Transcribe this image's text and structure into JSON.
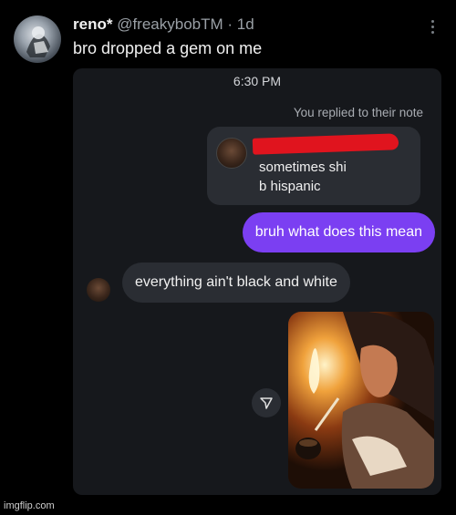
{
  "post": {
    "author_name": "reno*",
    "author_handle": "@freakybobTM · 1d",
    "text": "bro dropped a gem on me"
  },
  "dm": {
    "time": "6:30 PM",
    "reply_note": "You replied to their note",
    "note": {
      "line1": "sometimes shi",
      "line2": "b hispanic"
    },
    "sent_message": "bruh what does this mean",
    "received_message": "everything ain't black and white"
  },
  "watermark": "imgflip.com",
  "colors": {
    "sent_bubble": "#7b3ff2",
    "received_bubble": "#2a2d33",
    "redaction": "#e0141e"
  }
}
